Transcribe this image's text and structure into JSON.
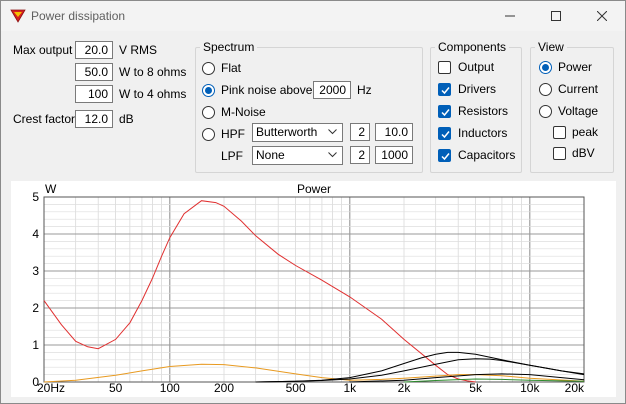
{
  "window": {
    "title": "Power dissipation",
    "icon": "superman-shield-icon"
  },
  "left_panel": {
    "max_output_label": "Max output",
    "max_output_value": "20.0",
    "max_output_unit": "V  RMS",
    "w8_value": "50.0",
    "w8_unit": "W to 8 ohms",
    "w4_value": "100",
    "w4_unit": "W to 4 ohms",
    "crest_label": "Crest factor",
    "crest_value": "12.0",
    "crest_unit": "dB"
  },
  "spectrum": {
    "title": "Spectrum",
    "flat": "Flat",
    "pink": "Pink noise above",
    "pink_value": "2000",
    "pink_unit": "Hz",
    "mnoise": "M-Noise",
    "hpf": "HPF",
    "hpf_type": "Butterworth",
    "hpf_order": "2",
    "hpf_freq": "10.0",
    "lpf": "LPF",
    "lpf_type": "None",
    "lpf_order": "2",
    "lpf_freq": "1000",
    "selected": "pink"
  },
  "components": {
    "title": "Components",
    "output": "Output",
    "drivers": "Drivers",
    "resistors": "Resistors",
    "inductors": "Inductors",
    "capacitors": "Capacitors",
    "checked": {
      "output": false,
      "drivers": true,
      "resistors": true,
      "inductors": true,
      "capacitors": true
    }
  },
  "view": {
    "title": "View",
    "power": "Power",
    "current": "Current",
    "voltage": "Voltage",
    "peak": "peak",
    "dbv": "dBV",
    "selected": "power",
    "peak_checked": false,
    "dbv_checked": false
  },
  "chart_data": {
    "type": "line",
    "title": "Power",
    "ylabel": "W",
    "xlabel": "",
    "xscale": "log",
    "xlim": [
      20,
      20000
    ],
    "ylim": [
      0,
      5
    ],
    "xticks": [
      20,
      50,
      100,
      200,
      500,
      1000,
      2000,
      5000,
      10000,
      20000
    ],
    "xtick_labels": [
      "20Hz",
      "50",
      "100",
      "200",
      "500",
      "1k",
      "2k",
      "5k",
      "10k",
      "20k"
    ],
    "yticks": [
      0,
      1,
      2,
      3,
      4,
      5
    ],
    "ytick_labels": [
      "0",
      "1",
      "2",
      "3",
      "4",
      "5"
    ],
    "grid": true,
    "series": [
      {
        "color": "#e03030",
        "x": [
          20,
          25,
          30,
          35,
          40,
          50,
          60,
          70,
          80,
          90,
          100,
          120,
          150,
          180,
          200,
          250,
          300,
          400,
          500,
          700,
          1000,
          1500,
          2000,
          3000,
          3500,
          4000,
          4500,
          5000
        ],
        "values": [
          2.2,
          1.55,
          1.1,
          0.95,
          0.9,
          1.15,
          1.6,
          2.2,
          2.8,
          3.4,
          3.9,
          4.55,
          4.9,
          4.85,
          4.75,
          4.35,
          3.95,
          3.45,
          3.15,
          2.75,
          2.3,
          1.7,
          1.15,
          0.45,
          0.2,
          0.08,
          0.03,
          0.0
        ]
      },
      {
        "color": "#e89a20",
        "x": [
          20,
          30,
          50,
          70,
          100,
          150,
          200,
          300,
          500,
          700,
          1000,
          1500,
          2000,
          3000,
          4000,
          5000,
          7000,
          10000,
          20000
        ],
        "values": [
          0.0,
          0.05,
          0.18,
          0.3,
          0.42,
          0.48,
          0.47,
          0.38,
          0.22,
          0.12,
          0.05,
          0.07,
          0.1,
          0.16,
          0.2,
          0.2,
          0.17,
          0.1,
          0.02
        ]
      },
      {
        "color": "#000000",
        "x": [
          300,
          500,
          700,
          1000,
          1500,
          2000,
          2500,
          3000,
          3500,
          4000,
          5000,
          7000,
          10000,
          15000,
          20000
        ],
        "values": [
          0.0,
          0.02,
          0.05,
          0.12,
          0.3,
          0.5,
          0.65,
          0.75,
          0.8,
          0.8,
          0.75,
          0.6,
          0.45,
          0.3,
          0.22
        ]
      },
      {
        "color": "#000000",
        "x": [
          300,
          500,
          700,
          1000,
          1500,
          2000,
          3000,
          4000,
          5000,
          6000,
          7000,
          10000,
          15000,
          20000
        ],
        "values": [
          0.0,
          0.02,
          0.04,
          0.08,
          0.18,
          0.3,
          0.48,
          0.6,
          0.63,
          0.62,
          0.58,
          0.45,
          0.3,
          0.2
        ]
      },
      {
        "color": "#000000",
        "x": [
          1000,
          2000,
          3000,
          5000,
          7000,
          10000,
          15000,
          20000
        ],
        "values": [
          0.0,
          0.05,
          0.12,
          0.2,
          0.22,
          0.2,
          0.12,
          0.06
        ]
      },
      {
        "color": "#2e8b2e",
        "x": [
          2000,
          3000,
          5000,
          7000,
          10000,
          15000,
          20000
        ],
        "values": [
          0.0,
          0.04,
          0.08,
          0.07,
          0.05,
          0.03,
          0.02
        ]
      }
    ]
  }
}
